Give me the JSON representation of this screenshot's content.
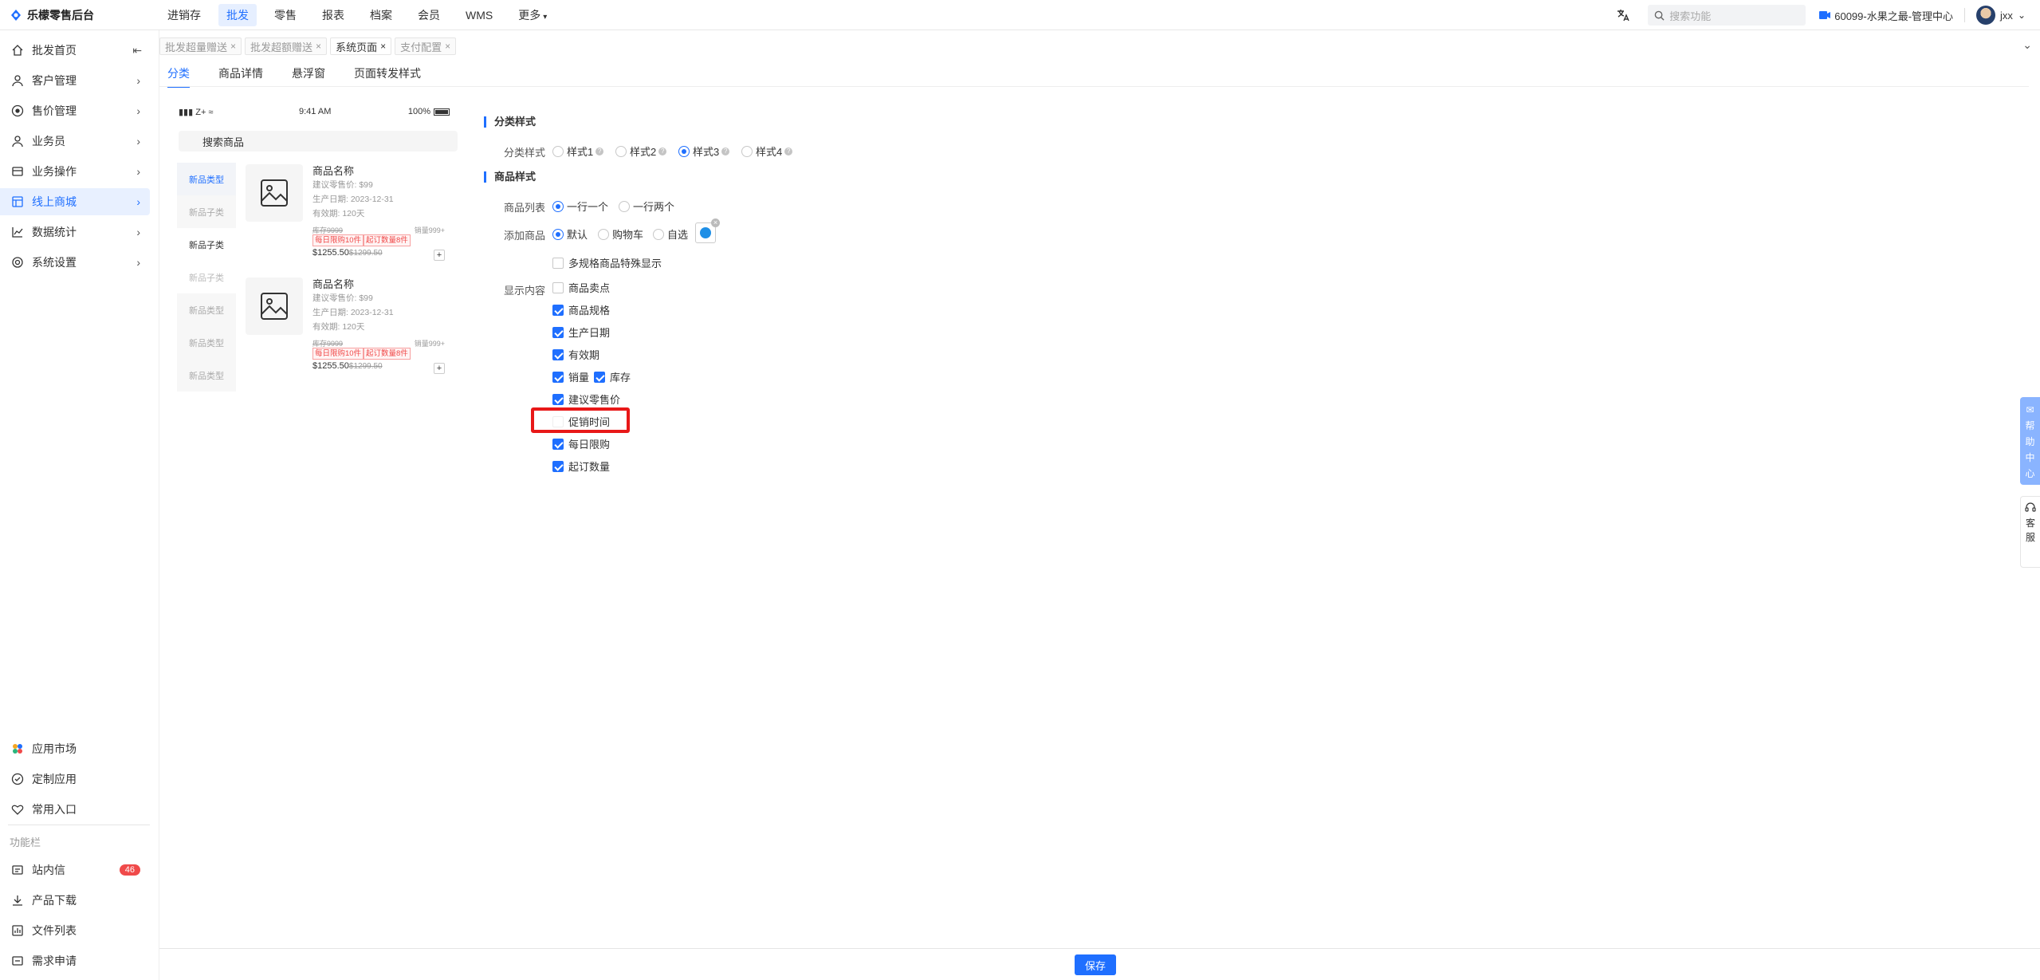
{
  "brand": {
    "name": "乐檬零售后台"
  },
  "topnav": {
    "items": [
      "进销存",
      "批发",
      "零售",
      "报表",
      "档案",
      "会员",
      "WMS",
      "更多"
    ],
    "active_index": 1
  },
  "topbar": {
    "search_placeholder": "搜索功能",
    "store": "60099-水果之最-管理中心",
    "user": "jxx"
  },
  "sidebar": {
    "items": [
      "批发首页",
      "客户管理",
      "售价管理",
      "业务员",
      "业务操作",
      "线上商城",
      "数据统计",
      "系统设置"
    ],
    "active_index": 5,
    "bottom_items": [
      "应用市场",
      "定制应用",
      "常用入口"
    ],
    "group_label": "功能栏",
    "func_items": [
      "站内信",
      "产品下载",
      "文件列表",
      "需求申请"
    ],
    "message_count": "46"
  },
  "page_tabs": [
    "批发超量赠送",
    "批发超额赠送",
    "系统页面",
    "支付配置"
  ],
  "active_page_tab": 2,
  "subtabs": [
    "分类",
    "商品详情",
    "悬浮窗",
    "页面转发样式"
  ],
  "phone": {
    "signal": "Z+",
    "time": "9:41 AM",
    "battery": "100%",
    "search_text": "搜索商品",
    "categories": [
      "新品类型",
      "新品子类",
      "新品子类",
      "新品子类",
      "新品类型",
      "新品类型",
      "新品类型"
    ],
    "goods": [
      {
        "name": "商品名称",
        "suggest": "建议零售价: $99",
        "date": "生产日期: 2023-12-31",
        "valid": "有效期: 120天",
        "stock": "库存9999",
        "sales": "销量999+",
        "tag1": "每日限购10件",
        "tag2": "起订数量8件",
        "price": "$1255.50",
        "orig_price": "$1299.50"
      },
      {
        "name": "商品名称",
        "suggest": "建议零售价: $99",
        "date": "生产日期: 2023-12-31",
        "valid": "有效期: 120天",
        "stock": "库存9999",
        "sales": "销量999+",
        "tag1": "每日限购10件",
        "tag2": "起订数量8件",
        "price": "$1255.50",
        "orig_price": "$1299.50"
      }
    ]
  },
  "settings": {
    "category_section": "分类样式",
    "category_label": "分类样式",
    "category_options": [
      "样式1",
      "样式2",
      "样式3",
      "样式4"
    ],
    "category_selected": 2,
    "goods_section": "商品样式",
    "list_label": "商品列表",
    "list_options": [
      "一行一个",
      "一行两个"
    ],
    "list_selected": 0,
    "add_label": "添加商品",
    "add_options": [
      "默认",
      "购物车",
      "自选"
    ],
    "add_selected": 0,
    "multi_spec": "多规格商品特殊显示",
    "display_label": "显示内容",
    "display_items": [
      {
        "label": "商品卖点",
        "checked": false
      },
      {
        "label": "商品规格",
        "checked": true
      },
      {
        "label": "生产日期",
        "checked": true
      },
      {
        "label": "有效期",
        "checked": true
      },
      {
        "label": "销量",
        "checked": true
      },
      {
        "label": "库存",
        "checked": true
      },
      {
        "label": "建议零售价",
        "checked": true
      },
      {
        "label": "促销时间",
        "checked": false
      },
      {
        "label": "每日限购",
        "checked": true
      },
      {
        "label": "起订数量",
        "checked": true
      }
    ]
  },
  "float": {
    "help": [
      "帮",
      "助",
      "中",
      "心"
    ],
    "service": [
      "客",
      "服"
    ]
  },
  "footer": {
    "save": "保存"
  },
  "colors": {
    "accent": "#1f6fff",
    "highlight": "#e81818",
    "badge": "#f04a4a"
  }
}
